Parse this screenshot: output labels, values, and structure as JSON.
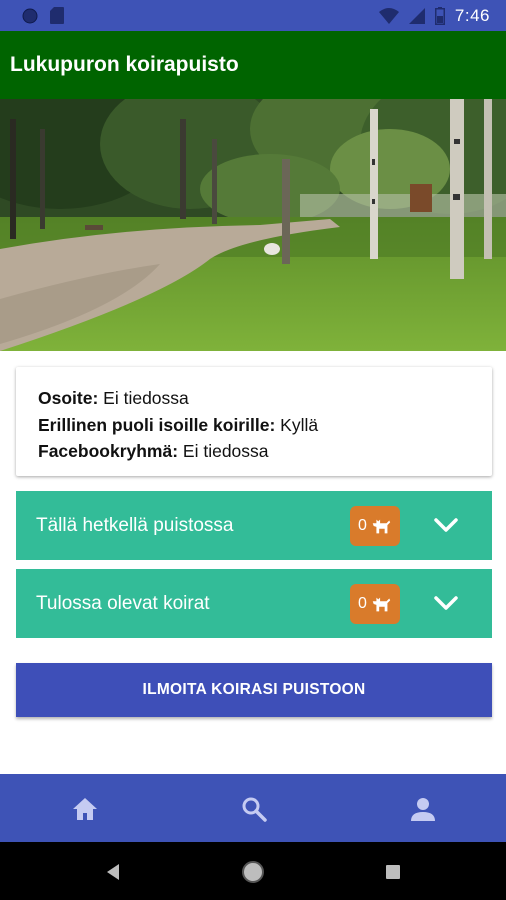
{
  "status_bar": {
    "time": "7:46",
    "icons": [
      "circle-icon",
      "sim-card-icon",
      "wifi-icon",
      "signal-icon",
      "battery-icon"
    ]
  },
  "app_bar": {
    "title": "Lukupuron koirapuisto",
    "color": "#006400"
  },
  "hero": {
    "description_icon": "park-photo"
  },
  "info": {
    "address_label": "Osoite:",
    "address_value": "Ei tiedossa",
    "separate_area_label": "Erillinen puoli isoille koirille:",
    "separate_area_value": "Kyllä",
    "facebook_label": "Facebookryhmä:",
    "facebook_value": "Ei tiedossa"
  },
  "panels": [
    {
      "label": "Tällä hetkellä puistossa",
      "count": "0",
      "icon": "dog-icon"
    },
    {
      "label": "Tulossa olevat koirat",
      "count": "0",
      "icon": "dog-icon"
    }
  ],
  "cta": {
    "label": "ILMOITA KOIRASI PUISTOON"
  },
  "bottom_nav": {
    "items": [
      "home-icon",
      "search-icon",
      "person-icon"
    ]
  },
  "colors": {
    "primary": "#3e53b6",
    "panel": "#33bc98",
    "badge": "#d97b2b",
    "button": "#3e4fb8"
  }
}
